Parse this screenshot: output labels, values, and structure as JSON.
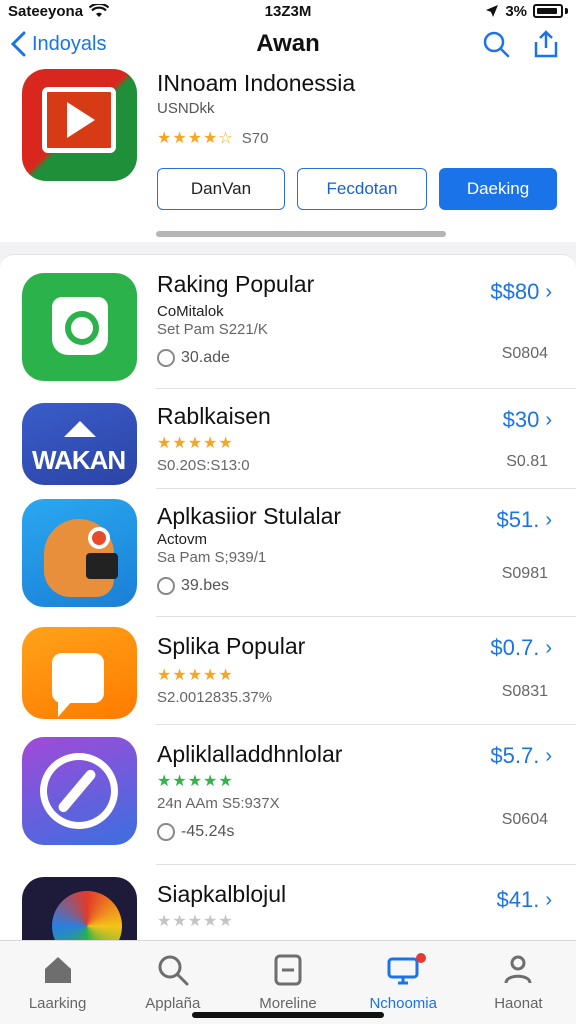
{
  "status": {
    "carrier": "Sateeyona",
    "time": "13Z3M",
    "battery": "3%"
  },
  "nav": {
    "back_label": "Indoyals",
    "title": "Awan"
  },
  "header": {
    "title": "INnoam Indonessia",
    "developer": "USNDkk",
    "rating_count": "S70",
    "buttons": [
      "DanVan",
      "Fecdotan",
      "Daeking"
    ]
  },
  "apps": [
    {
      "name": "Raking Popular",
      "line2": "CoMitalok",
      "line3": "Set Pam  S221/K",
      "line4": "30.ade",
      "price": "$$80",
      "price_sub": "S0804",
      "stars": "",
      "star_color": ""
    },
    {
      "name": "Rablkaisen",
      "line2": "",
      "line3": "S0.20S:S13:0",
      "line4": "",
      "price": "$30",
      "price_sub": "S0.81",
      "stars": "★★★★★",
      "star_color": "orange"
    },
    {
      "name": "Aplkasiior Stulalar",
      "line2": "Actovm",
      "line3": "Sa Pam  S;939/1",
      "line4": "39.bes",
      "price": "$51.",
      "price_sub": "S0981",
      "stars": "",
      "star_color": ""
    },
    {
      "name": "Splika Popular",
      "line2": "",
      "line3": "S2.0012835.37%",
      "line4": "",
      "price": "$0.7.",
      "price_sub": "S0831",
      "stars": "★★★★★",
      "star_color": "orange"
    },
    {
      "name": "Apliklalladdhnlolar",
      "line2": "",
      "line3": "24n AAm  S5:937X",
      "line4": "-45.24s",
      "price": "$5.7.",
      "price_sub": "S0604",
      "stars": "★★★★★",
      "star_color": "green"
    },
    {
      "name": "Siapkalblojul",
      "line2": "",
      "line3": "",
      "line4": "",
      "price": "$41.",
      "price_sub": "",
      "stars": "★★★★★",
      "star_color": "grey"
    }
  ],
  "tabs": [
    "Laarking",
    "Applaña",
    "Moreline",
    "Nchoomia",
    "Haonat"
  ]
}
